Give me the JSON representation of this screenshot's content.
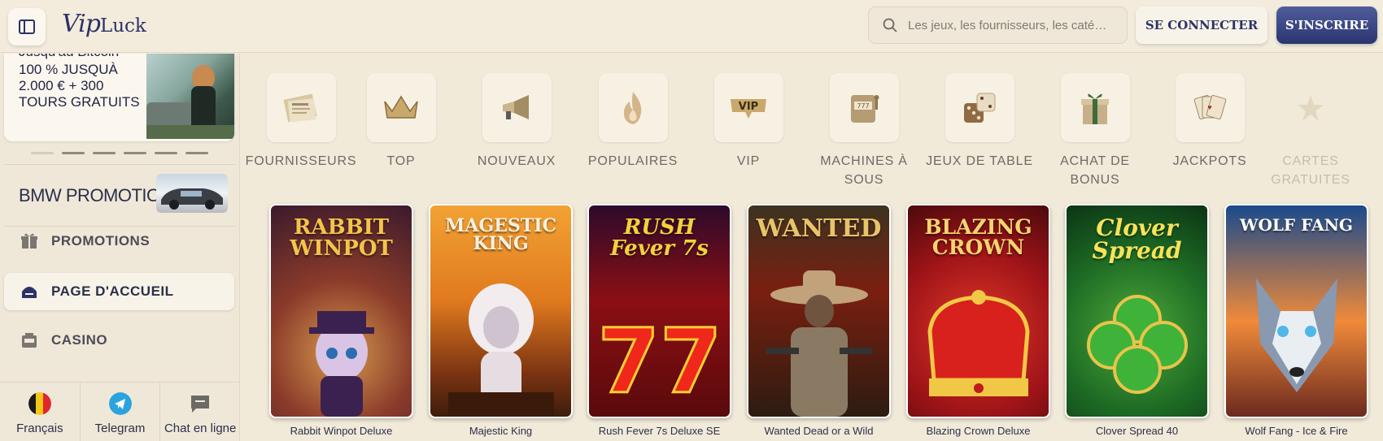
{
  "header": {
    "logo_vip": "Vip",
    "logo_luck": "Luck",
    "search_placeholder": "Les jeux, les fournisseurs, les caté…",
    "login_label": "SE CONNECTER",
    "register_label": "S'INSCRIRE"
  },
  "sidebar": {
    "promo_banner": {
      "cut_line": "Jusqu'au Bitcoin",
      "line1": "100 % JUSQUÀ",
      "line2": "2.000 € + 300",
      "line3": "TOURS GRATUITS"
    },
    "bmw_label": "BMW PROMOTION",
    "nav_items": [
      {
        "label": "PROMOTIONS",
        "icon": "gift-icon"
      },
      {
        "label": "PAGE D'ACCUEIL",
        "icon": "home-icon"
      },
      {
        "label": "CASINO",
        "icon": "casino-icon"
      }
    ],
    "bottom": {
      "language": "Français",
      "telegram": "Telegram",
      "chat": "Chat en ligne"
    }
  },
  "categories": [
    {
      "label": "FOURNISSEURS",
      "icon": "newspaper-icon"
    },
    {
      "label": "TOP",
      "icon": "crown-icon"
    },
    {
      "label": "NOUVEAUX",
      "icon": "megaphone-icon"
    },
    {
      "label": "POPULAIRES",
      "icon": "flame-icon"
    },
    {
      "label": "VIP",
      "icon": "vip-icon"
    },
    {
      "label": "MACHINES À SOUS",
      "icon": "slot-machine-icon"
    },
    {
      "label": "JEUX DE TABLE",
      "icon": "dice-icon"
    },
    {
      "label": "ACHAT DE BONUS",
      "icon": "gift-box-icon"
    },
    {
      "label": "JACKPOTS",
      "icon": "cards-icon"
    },
    {
      "label": "CARTES GRATUITES",
      "icon": "star-icon"
    }
  ],
  "games": [
    {
      "name": "Rabbit Winpot Deluxe",
      "art_title": "RABBIT WINPOT"
    },
    {
      "name": "Majestic King",
      "art_title": "MAGESTIC KING"
    },
    {
      "name": "Rush Fever 7s Deluxe SE",
      "art_title": "RUSH Fever 7s"
    },
    {
      "name": "Wanted Dead or a Wild",
      "art_title": "WANTED"
    },
    {
      "name": "Blazing Crown Deluxe",
      "art_title": "BLAZING CROWN"
    },
    {
      "name": "Clover Spread 40",
      "art_title": "Clover Spread"
    },
    {
      "name": "Wolf Fang - Ice & Fire",
      "art_title": "WOLF FANG"
    }
  ],
  "colors": {
    "accent": "#2c3266",
    "background": "#f1ead9"
  }
}
